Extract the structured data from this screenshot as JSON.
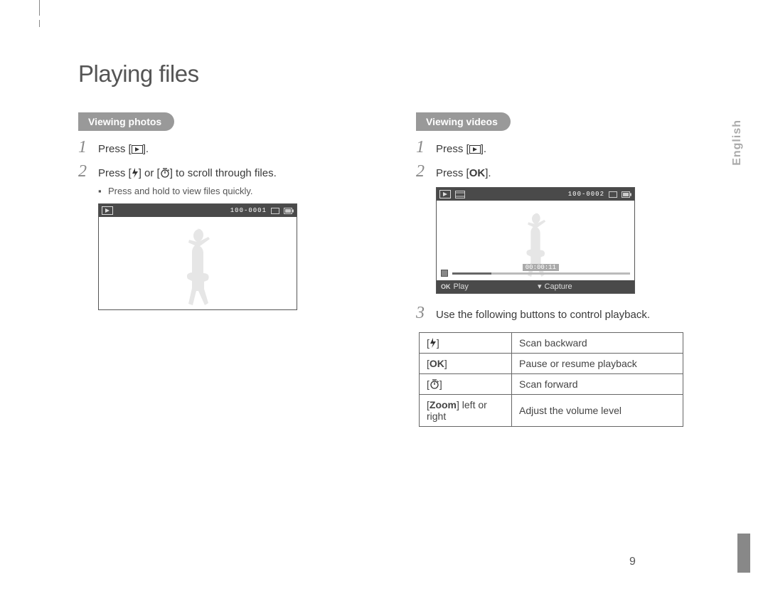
{
  "header": {
    "title": "Playing files",
    "language_tab": "English"
  },
  "photos": {
    "section": "Viewing photos",
    "steps": {
      "s1": "Press [",
      "s1_end": "].",
      "s2_a": "Press [",
      "s2_b": "] or [",
      "s2_c": "] to scroll through files.",
      "bullet": "Press and hold to view files quickly."
    },
    "lcd": {
      "counter": "100-0001"
    }
  },
  "videos": {
    "section": "Viewing videos",
    "steps": {
      "s1": "Press [",
      "s1_end": "].",
      "s2": "Press [",
      "s2_end": "].",
      "s3": "Use the following buttons to control playback."
    },
    "lcd": {
      "counter": "100-0002",
      "time": "00:00:11",
      "play_label": "Play",
      "capture_label": "Capture",
      "ok_label": "OK"
    },
    "table": {
      "r1_desc": "Scan backward",
      "r2_key": "OK",
      "r2_desc": "Pause or resume playback",
      "r3_desc": "Scan forward",
      "r4_key_a": "Zoom",
      "r4_key_b": " left or right",
      "r4_desc": "Adjust the volume level"
    }
  },
  "page_number": "9"
}
